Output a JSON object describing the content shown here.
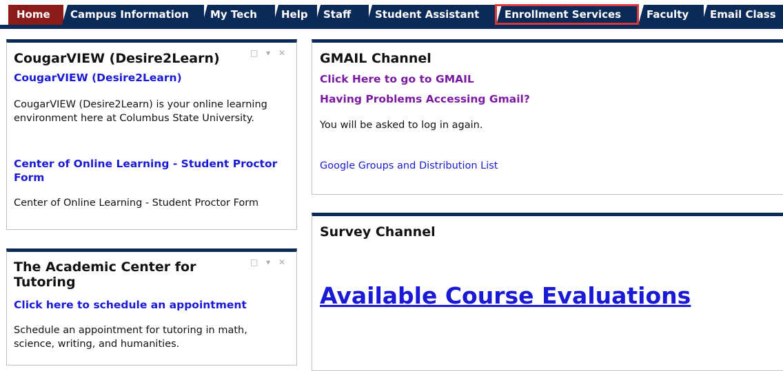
{
  "tabs": [
    {
      "label": "Home"
    },
    {
      "label": "Campus Information"
    },
    {
      "label": "My Tech"
    },
    {
      "label": "Help"
    },
    {
      "label": "Staff"
    },
    {
      "label": "Student Assistant"
    },
    {
      "label": "Enrollment Services"
    },
    {
      "label": "Faculty"
    },
    {
      "label": "Email Class"
    }
  ],
  "cougar": {
    "title": "CougarVIEW (Desire2Learn)",
    "link": "CougarVIEW (Desire2Learn)",
    "desc": "CougarVIEW (Desire2Learn) is your online learning environment here at Columbus State University.",
    "link2": "Center of Online Learning - Student Proctor Form",
    "desc2": "Center of Online Learning - Student Proctor Form"
  },
  "tutoring": {
    "title": "The Academic Center for Tutoring",
    "link": "Click here to schedule an appointment",
    "desc": "Schedule an appointment for tutoring in math, science, writing, and humanities."
  },
  "gmail": {
    "title": "GMAIL Channel",
    "link1": "Click Here to go to GMAIL",
    "link2": "Having Problems Accessing Gmail?",
    "desc": "You will be asked to log in again.",
    "link3": "Google Groups and Distribution List"
  },
  "survey": {
    "title": "Survey Channel",
    "link": "Available Course Evaluations"
  },
  "portlet_controls": "□ ▾ ✕"
}
